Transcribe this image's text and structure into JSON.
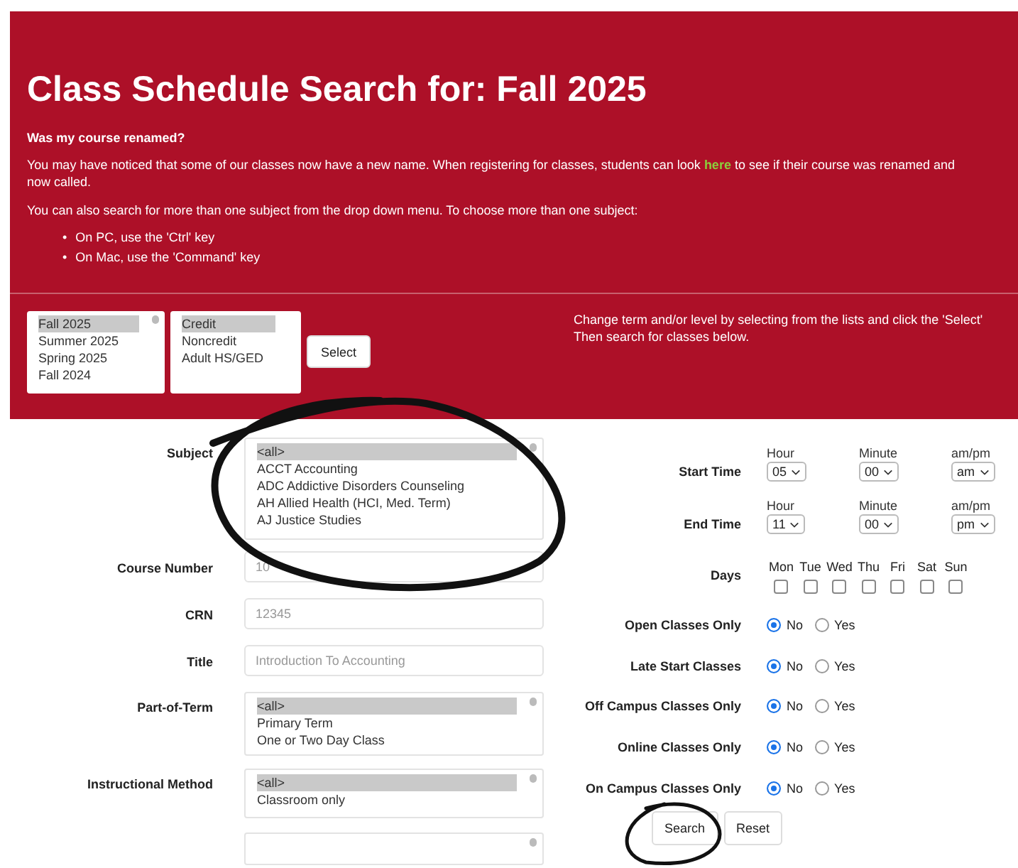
{
  "header": {
    "title": "Class Schedule Search for: Fall 2025",
    "notice_heading": "Was my course renamed?",
    "notice": {
      "before": "You may have noticed that some of our classes now have a new name. When registering for classes, students can look",
      "link": "here",
      "after": "to see if their course was renamed and",
      "continued": "now called."
    },
    "hint": "You can also search for more than one subject from the drop down menu. To choose more than one subject:",
    "tips": [
      {
        "marker": "•",
        "text": "On PC, use the 'Ctrl' key"
      },
      {
        "marker": "•",
        "text": "On Mac, use the 'Command' key"
      }
    ]
  },
  "term_list": [
    {
      "label": "Fall 2025",
      "selected": true
    },
    {
      "label": "Summer 2025",
      "selected": false
    },
    {
      "label": "Spring 2025",
      "selected": false
    },
    {
      "label": "Fall 2024",
      "selected": false
    }
  ],
  "level_list": [
    {
      "label": "Credit",
      "selected": true
    },
    {
      "label": "Noncredit",
      "selected": false
    },
    {
      "label": "Adult HS/GED",
      "selected": false
    }
  ],
  "select_button": "Select",
  "term_instructions": [
    "Change term and/or level by selecting from the lists and click the 'Select'",
    "Then search for classes below."
  ],
  "left_fields": [
    {
      "kind": "listbox",
      "label": "Subject",
      "options": [
        {
          "label": "<all>",
          "selected": true
        },
        {
          "label": "ACCT Accounting",
          "selected": false
        },
        {
          "label": "ADC Addictive Disorders Counseling",
          "selected": false
        },
        {
          "label": "AH Allied Health (HCI, Med. Term)",
          "selected": false
        },
        {
          "label": "AJ Justice Studies",
          "selected": false
        }
      ]
    },
    {
      "kind": "text",
      "label": "Course Number",
      "placeholder": "10"
    },
    {
      "kind": "text",
      "label": "CRN",
      "placeholder": "12345"
    },
    {
      "kind": "text",
      "label": "Title",
      "placeholder": "Introduction To Accounting"
    },
    {
      "kind": "listbox",
      "label": "Part-of-Term",
      "options": [
        {
          "label": "<all>",
          "selected": true
        },
        {
          "label": "Primary Term",
          "selected": false
        },
        {
          "label": "One or Two Day Class",
          "selected": false
        }
      ]
    },
    {
      "kind": "listbox",
      "label": "Instructional Method",
      "options": [
        {
          "label": "<all>",
          "selected": true
        },
        {
          "label": "Classroom only",
          "selected": false
        }
      ]
    },
    {
      "kind": "listbox"
    }
  ],
  "times": [
    {
      "label": "Start Time",
      "parts": [
        {
          "caption": "Hour",
          "value": "05"
        },
        {
          "caption": "Minute",
          "value": "00"
        },
        {
          "caption": "am/pm",
          "value": "am"
        }
      ]
    },
    {
      "label": "End Time",
      "parts": [
        {
          "caption": "Hour",
          "value": "11"
        },
        {
          "caption": "Minute",
          "value": "00"
        },
        {
          "caption": "am/pm",
          "value": "pm"
        }
      ]
    }
  ],
  "days": {
    "label": "Days",
    "items": [
      {
        "label": "Mon",
        "checked": false
      },
      {
        "label": "Tue",
        "checked": false
      },
      {
        "label": "Wed",
        "checked": false
      },
      {
        "label": "Thu",
        "checked": false
      },
      {
        "label": "Fri",
        "checked": false
      },
      {
        "label": "Sat",
        "checked": false
      },
      {
        "label": "Sun",
        "checked": false
      }
    ]
  },
  "radio_rows": [
    {
      "label": "Open Classes Only",
      "options": [
        {
          "label": "No",
          "selected": true
        },
        {
          "label": "Yes",
          "selected": false
        }
      ]
    },
    {
      "label": "Late Start Classes",
      "options": [
        {
          "label": "No",
          "selected": true
        },
        {
          "label": "Yes",
          "selected": false
        }
      ]
    },
    {
      "label": "Off Campus Classes Only",
      "options": [
        {
          "label": "No",
          "selected": true
        },
        {
          "label": "Yes",
          "selected": false
        }
      ]
    },
    {
      "label": "Online Classes Only",
      "options": [
        {
          "label": "No",
          "selected": true
        },
        {
          "label": "Yes",
          "selected": false
        }
      ]
    },
    {
      "label": "On Campus Classes Only",
      "options": [
        {
          "label": "No",
          "selected": true
        },
        {
          "label": "Yes",
          "selected": false
        }
      ]
    }
  ],
  "buttons": [
    "Search",
    "Reset"
  ]
}
